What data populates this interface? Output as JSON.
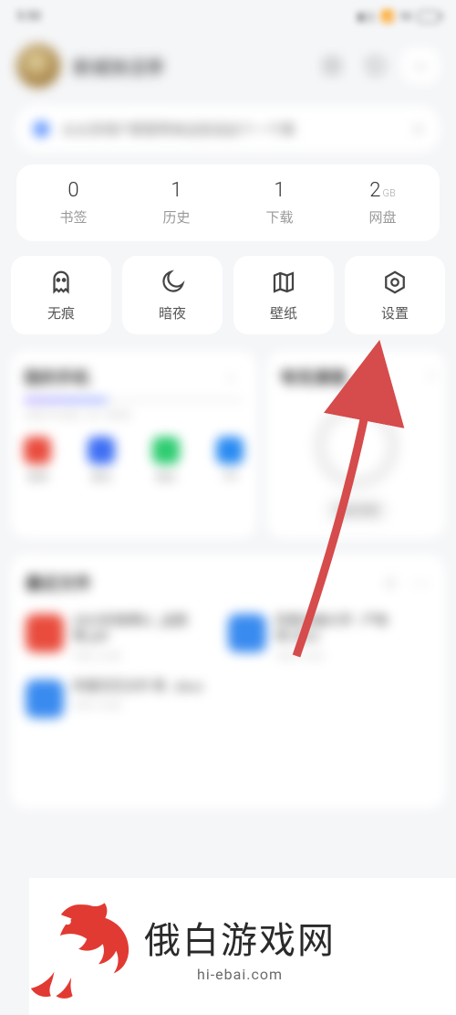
{
  "statusbar": {
    "time": "5:50"
  },
  "header": {
    "username": "新城快活亭"
  },
  "notice": {
    "text": "从众多用户那里带来这些话这个一个窝",
    "close": "×"
  },
  "stats": [
    {
      "value": "0",
      "label": "书签"
    },
    {
      "value": "1",
      "label": "历史"
    },
    {
      "value": "1",
      "label": "下载"
    },
    {
      "value": "2",
      "unit": "GB",
      "label": "网盘"
    }
  ],
  "tools": [
    {
      "label": "无痕"
    },
    {
      "label": "暗夜"
    },
    {
      "label": "壁纸"
    },
    {
      "label": "设置"
    }
  ],
  "phone": {
    "title": "我的手机",
    "subtitle": "已用 39.8GB / 共 128GB",
    "apps": [
      {
        "label": "微博",
        "color": "#e94c3d"
      },
      {
        "label": "腾讯",
        "color": "#3e6ff4"
      },
      {
        "label": "微信",
        "color": "#2ecc71"
      },
      {
        "label": "QQ",
        "color": "#2a8bf2"
      }
    ]
  },
  "clean": {
    "title": "夸克清理",
    "button": "深度清理"
  },
  "recent": {
    "title": "最近文件",
    "items": [
      {
        "t1": "2023年微博以 _品图像.pdf",
        "t2": "今天 13:30",
        "color": "#e94c3d"
      },
      {
        "t1": "阿里全面大学 - 产物库.docx",
        "t2": "今天 13:29",
        "color": "#3a8bf0"
      },
      {
        "t1": "阿里巴巴文件 等. .docx",
        "t2": "今天 13:28",
        "color": "#3a8bf0"
      }
    ]
  },
  "watermark": {
    "main": "俄白游戏网",
    "sub": "hi-ebai.com"
  }
}
